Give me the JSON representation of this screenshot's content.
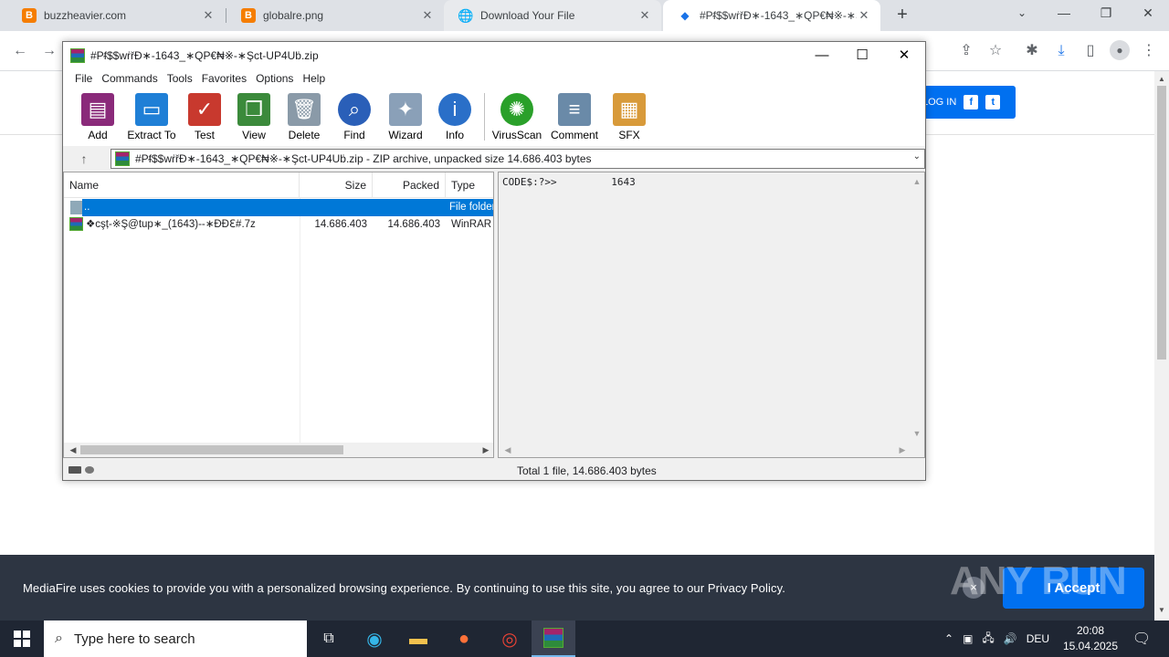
{
  "browser": {
    "tabs": [
      {
        "label": "buzzheavier.com",
        "icon": "B"
      },
      {
        "label": "globalre.png",
        "icon": "B"
      },
      {
        "label": "Download Your File",
        "icon": "globe-icon"
      },
      {
        "label": "#Pᵮ$$wṙřĐ∗-1643_∗QP€₦※-∗Ş",
        "icon": "mediafire-icon"
      }
    ],
    "new_tab": "+"
  },
  "page": {
    "login": "LOG IN",
    "facebook": "f",
    "twitter": "t"
  },
  "cookie": {
    "message": "MediaFire uses cookies to provide you with a personalized browsing experience. By continuing to use this site, you agree to our Privacy Policy.",
    "accept": "I Accept",
    "close": "×"
  },
  "watermark": "ANY RUN",
  "winrar": {
    "title": "#Pᵮ$$wṙřĐ∗-1643_∗QP€₦※-∗Şct-UP4Uḃ.zip",
    "menu": [
      "File",
      "Commands",
      "Tools",
      "Favorites",
      "Options",
      "Help"
    ],
    "tools": [
      {
        "label": "Add",
        "color": "#8a2a7a"
      },
      {
        "label": "Extract To",
        "color": "#1f7fd6"
      },
      {
        "label": "Test",
        "color": "#c8392e"
      },
      {
        "label": "View",
        "color": "#3b8a3b"
      },
      {
        "label": "Delete",
        "color": "#8a9aa8"
      },
      {
        "label": "Find",
        "color": "#2a5fb8"
      },
      {
        "label": "Wizard",
        "color": "#8aa0b8"
      },
      {
        "label": "Info",
        "color": "#2a6fc8"
      },
      {
        "label": "VirusScan",
        "color": "#2aa02a"
      },
      {
        "label": "Comment",
        "color": "#6a8aa8"
      },
      {
        "label": "SFX",
        "color": "#d89a3a"
      }
    ],
    "address": "#Pᵮ$$wṙřĐ∗-1643_∗QP€₦※-∗Şct-UP4Uḃ.zip - ZIP archive, unpacked size 14.686.403 bytes",
    "columns": [
      "Name",
      "Size",
      "Packed",
      "Type"
    ],
    "rows": [
      {
        "name": "..",
        "size": "",
        "packed": "",
        "type": "File folder"
      },
      {
        "name": "❖cşṭ-※Ş@tup∗_(1643)--∗ƉĐℇ#.7z",
        "size": "14.686.403",
        "packed": "14.686.403",
        "type": "WinRAR"
      }
    ],
    "comment": "CODE$:?>>         1643",
    "status": "Total 1 file, 14.686.403 bytes"
  },
  "taskbar": {
    "search_placeholder": "Type here to search",
    "lang": "DEU",
    "time": "20:08",
    "date": "15.04.2025"
  }
}
